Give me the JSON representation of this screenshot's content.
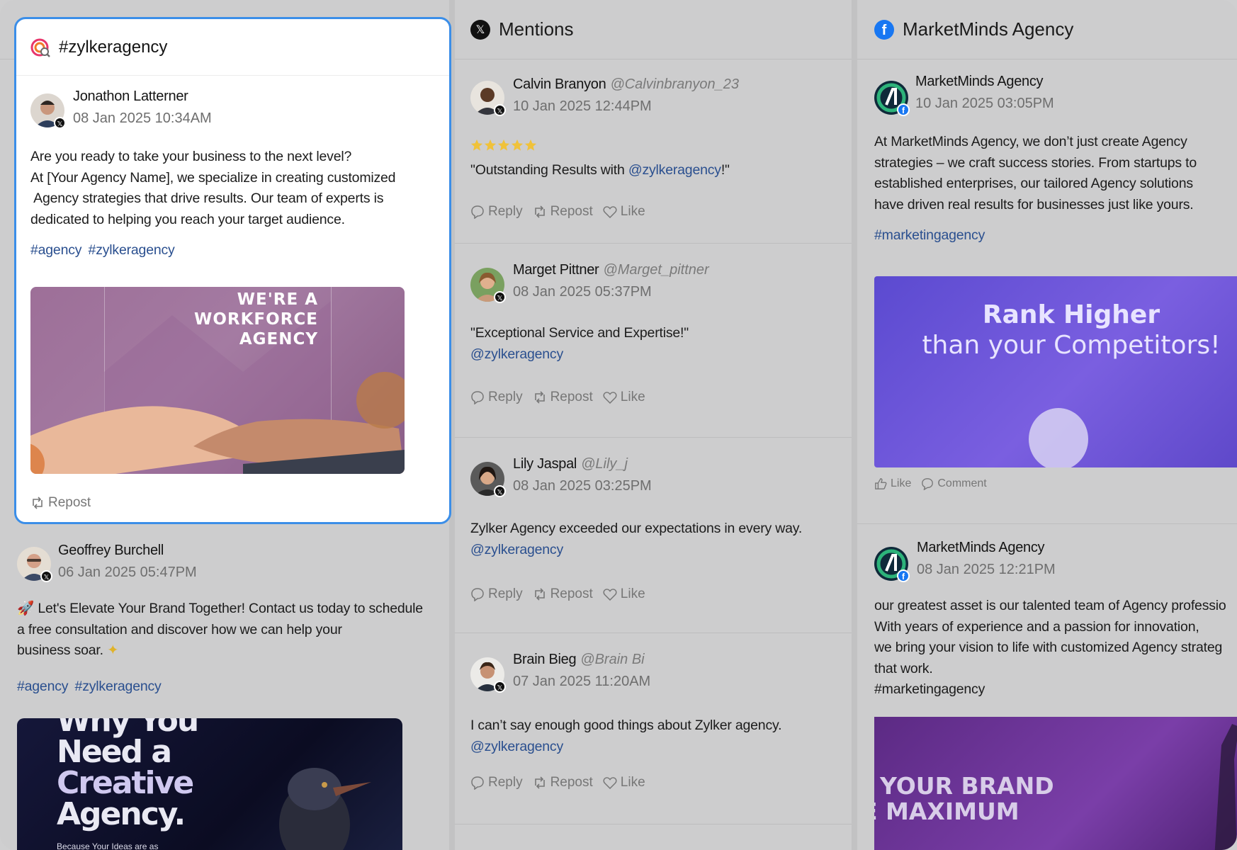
{
  "col1": {
    "card": {
      "title": "#zylkeragency",
      "post": {
        "author": "Jonathon Latterner",
        "date": "08 Jan 2025 10:34AM",
        "lines": [
          "Are you ready to take your business to the next level?",
          "At [Your Agency Name], we specialize in creating customized",
          " Agency strategies that drive results. Our team of experts is",
          "dedicated to helping you reach your target audience."
        ],
        "tags": [
          "#agency",
          "#zylkeragency"
        ],
        "image_text": [
          "WE'RE A",
          "WORKFORCE",
          "AGENCY"
        ],
        "repost": "Repost"
      }
    },
    "post2": {
      "author": "Geoffrey Burchell",
      "date": "06 Jan 2025 05:47PM",
      "lines": [
        "Let's Elevate Your Brand Together! Contact us today to schedule",
        "a free consultation and discover how we can help your",
        "business soar."
      ],
      "tags": [
        "#agency",
        "#zylkeragency"
      ],
      "image_text": [
        "Why You",
        "Need a",
        "Creative",
        "Agency.",
        "Because Your Ideas are as"
      ]
    }
  },
  "col2": {
    "title": "Mentions",
    "actions": {
      "reply": "Reply",
      "repost": "Repost",
      "like": "Like"
    },
    "posts": [
      {
        "author": "Calvin Branyon",
        "handle": "@Calvinbranyon_23",
        "date": "10 Jan 2025 12:44PM",
        "pre": "\"Outstanding Results with ",
        "mention": "@zylkeragency",
        "post": "!\""
      },
      {
        "author": "Marget Pittner",
        "handle": "@Marget_pittner",
        "date": "08 Jan 2025 05:37PM",
        "text": "\"Exceptional Service and Expertise!\"",
        "mention": "@zylkeragency"
      },
      {
        "author": "Lily Jaspal",
        "handle": "@Lily_j",
        "date": "08 Jan 2025 03:25PM",
        "text": "Zylker Agency exceeded our expectations in every way.",
        "mention": "@zylkeragency"
      },
      {
        "author": "Brain Bieg",
        "handle": "@Brain Bi",
        "date": "07 Jan 2025 11:20AM",
        "text": "I can’t say enough good things about Zylker agency.",
        "mention": "@zylkeragency"
      }
    ]
  },
  "col3": {
    "title": "MarketMinds Agency",
    "post1": {
      "author": "MarketMinds Agency",
      "date": "10 Jan 2025 03:05PM",
      "lines": [
        "At MarketMinds Agency, we don’t just create Agency",
        "strategies – we craft success stories. From startups to",
        "established enterprises, our tailored Agency solutions",
        "have driven real results for businesses just like yours."
      ],
      "tag": "#marketingagency",
      "image_text": [
        "Rank Higher",
        "than your Competitors!"
      ],
      "like": "Like",
      "comment": "Comment"
    },
    "post2": {
      "author": "MarketMinds Agency",
      "date": "08 Jan 2025 12:21PM",
      "lines": [
        "our greatest asset is our talented team of Agency professio",
        "With years of experience and a passion for innovation,",
        "we bring your vision to life with customized Agency strateg",
        "that work.",
        "#marketingagency"
      ],
      "image_text": [
        "YOUR BRAND",
        "E MAXIMUM"
      ]
    }
  },
  "colors": {
    "accent": "#3b8ee8",
    "link": "#2a4f8f",
    "facebook": "#1877f2",
    "panel_bg": "#cdcdce"
  },
  "icons": [
    "search-listening-icon",
    "x-logo-icon",
    "facebook-logo-icon",
    "reply-icon",
    "repost-icon",
    "like-icon",
    "thumbs-up-icon",
    "comment-icon",
    "star-icon",
    "rocket-icon",
    "sparkle-icon"
  ]
}
